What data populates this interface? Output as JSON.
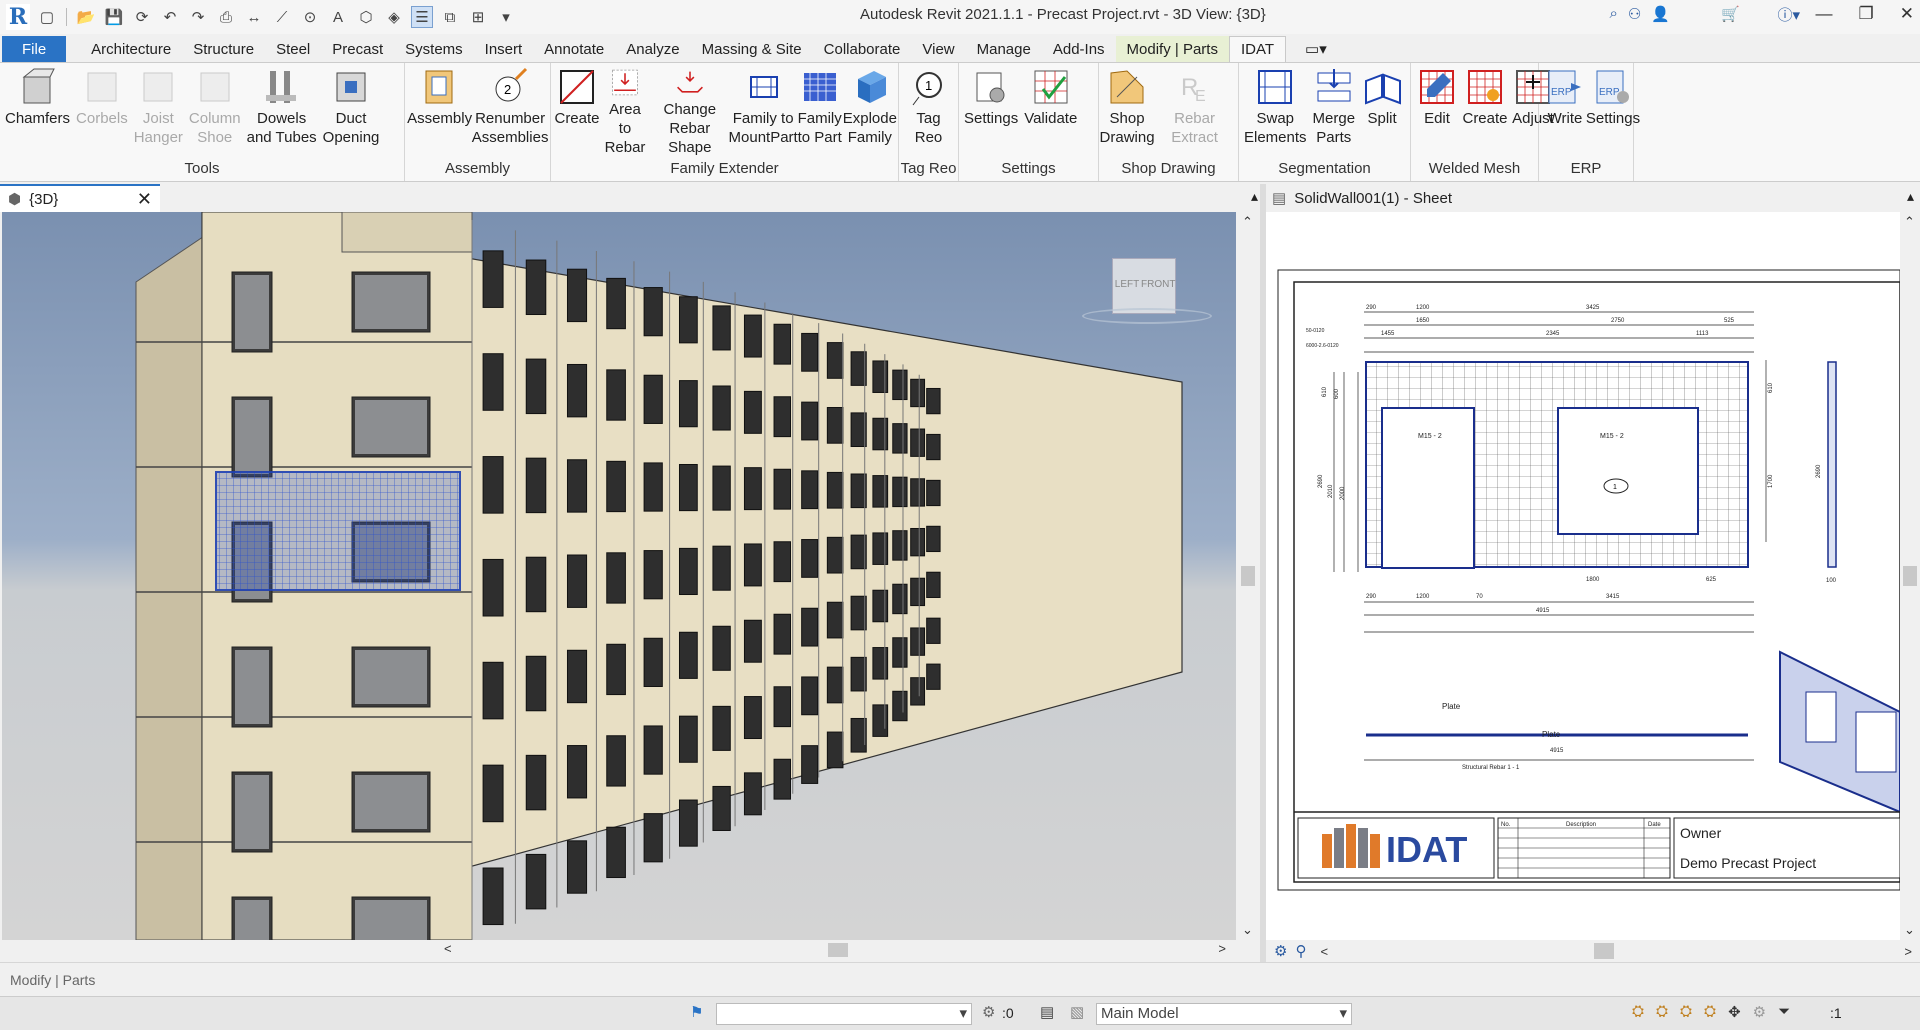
{
  "window": {
    "title": "Autodesk Revit 2021.1.1 - Precast Project.rvt - 3D View: {3D}",
    "logo": "R"
  },
  "menu": {
    "tabs": [
      "File",
      "Architecture",
      "Structure",
      "Steel",
      "Precast",
      "Systems",
      "Insert",
      "Annotate",
      "Analyze",
      "Massing & Site",
      "Collaborate",
      "View",
      "Manage",
      "Add-Ins",
      "Modify | Parts",
      "IDAT"
    ]
  },
  "ribbon": {
    "panels": [
      {
        "title": "Tools",
        "buttons": [
          {
            "label": "Chamfers",
            "icon": "chamfer-icon",
            "disabled": false
          },
          {
            "label": "Corbels",
            "icon": "corbel-icon",
            "disabled": true
          },
          {
            "label": "Joist\nHanger",
            "icon": "joist-hanger-icon",
            "disabled": true
          },
          {
            "label": "Column\nShoe",
            "icon": "column-shoe-icon",
            "disabled": true
          },
          {
            "label": "Dowels\nand Tubes",
            "icon": "dowels-icon",
            "disabled": false
          },
          {
            "label": "Duct\nOpening",
            "icon": "duct-opening-icon",
            "disabled": false
          }
        ]
      },
      {
        "title": "Assembly",
        "buttons": [
          {
            "label": "Assembly",
            "icon": "assembly-icon",
            "disabled": false
          },
          {
            "label": "Renumber\nAssemblies",
            "icon": "renumber-icon",
            "disabled": false
          }
        ]
      },
      {
        "title": "Family Extender",
        "buttons": [
          {
            "label": "Create",
            "icon": "create-family-icon",
            "disabled": false
          },
          {
            "label": "Area to\nRebar",
            "icon": "area-rebar-icon",
            "disabled": false
          },
          {
            "label": "Change\nRebar Shape",
            "icon": "rebar-shape-icon",
            "disabled": false
          },
          {
            "label": "Family to\nMountPart",
            "icon": "mountpart-icon",
            "disabled": false
          },
          {
            "label": "Family\nto Part",
            "icon": "family-part-icon",
            "disabled": false
          },
          {
            "label": "Explode\nFamily",
            "icon": "explode-icon",
            "disabled": false
          }
        ]
      },
      {
        "title": "Tag Reo",
        "buttons": [
          {
            "label": "Tag Reo",
            "icon": "tag-reo-icon",
            "disabled": false
          }
        ]
      },
      {
        "title": "Settings",
        "buttons": [
          {
            "label": "Settings",
            "icon": "settings-icon",
            "disabled": false
          },
          {
            "label": "Validate",
            "icon": "validate-icon",
            "disabled": false
          }
        ]
      },
      {
        "title": "Shop Drawing",
        "buttons": [
          {
            "label": "Shop\nDrawing",
            "icon": "shop-drawing-icon",
            "disabled": false
          },
          {
            "label": "Rebar Extract",
            "icon": "rebar-extract-icon",
            "disabled": true
          }
        ]
      },
      {
        "title": "Segmentation",
        "buttons": [
          {
            "label": "Swap\nElements",
            "icon": "swap-icon",
            "disabled": false
          },
          {
            "label": "Merge\nParts",
            "icon": "merge-icon",
            "disabled": false
          },
          {
            "label": "Split",
            "icon": "split-icon",
            "disabled": false
          }
        ]
      },
      {
        "title": "Welded Mesh",
        "buttons": [
          {
            "label": "Edit",
            "icon": "mesh-edit-icon",
            "disabled": false
          },
          {
            "label": "Create",
            "icon": "mesh-create-icon",
            "disabled": false
          },
          {
            "label": "Adjust",
            "icon": "mesh-adjust-icon",
            "disabled": false
          }
        ]
      },
      {
        "title": "ERP",
        "buttons": [
          {
            "label": "Write",
            "icon": "erp-write-icon",
            "disabled": false
          },
          {
            "label": "Settings",
            "icon": "erp-settings-icon",
            "disabled": false
          }
        ]
      }
    ]
  },
  "views": {
    "left_tab": "{3D}",
    "right_tab": "SolidWall001(1) - Sheet",
    "viewcube_left": "LEFT",
    "viewcube_front": "FRONT"
  },
  "sheet": {
    "dims_top": [
      "290",
      "1200",
      "3425",
      "1650",
      "2750",
      "525",
      "1455",
      "2345",
      "1113"
    ],
    "dims_bottom": [
      "290",
      "1200",
      "70",
      "3415",
      "4915"
    ],
    "dims_inner": [
      "1800",
      "625"
    ],
    "dims_left": [
      "610",
      "600",
      "2690",
      "2010",
      "2000"
    ],
    "dims_right": [
      "610",
      "1700"
    ],
    "dims_side": [
      "2690",
      "100"
    ],
    "mesh_label_1": "M15 - 2",
    "mesh_label_2": "M15 - 2",
    "tag": "1",
    "plate_label_1": "Plate",
    "plate_label_2": "Plate",
    "section_dim": "4915",
    "section_title": "Structural Rebar 1 - 1",
    "left_small_1": "50-0120",
    "left_small_2": "6000-2.6-0120",
    "logo_text": "IDAT",
    "table_headers": [
      "No.",
      "Description",
      "Date"
    ],
    "owner": "Owner",
    "project": "Demo Precast Project"
  },
  "status": {
    "text": "Modify | Parts",
    "selection_count": ":0",
    "workset": "Main Model",
    "filter_count": ":1"
  },
  "colors": {
    "accent": "#2a73c5",
    "selection": "#1f4fd1",
    "wall": "#e8dfc4"
  }
}
